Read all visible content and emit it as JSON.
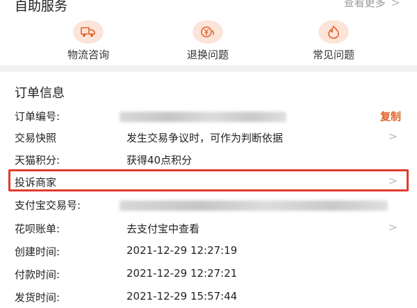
{
  "self_service": {
    "title": "自助服务",
    "see_more": "查看更多",
    "items": [
      {
        "label": "物流咨询",
        "icon": "truck-icon"
      },
      {
        "label": "退换问题",
        "icon": "yuan-exchange-icon"
      },
      {
        "label": "常见问题",
        "icon": "flame-question-icon"
      }
    ]
  },
  "order_info": {
    "title": "订单信息",
    "rows": [
      {
        "key": "订单编号:",
        "value": "",
        "action": "复制"
      },
      {
        "key": "交易快照",
        "value": "发生交易争议时，可作为判断依据"
      },
      {
        "key": "天猫积分:",
        "value": "获得40点积分"
      },
      {
        "key": "投诉商家",
        "value": ""
      },
      {
        "key": "支付宝交易号:",
        "value": ""
      },
      {
        "key": "花呗账单:",
        "value": "去支付宝中查看"
      },
      {
        "key": "创建时间:",
        "value": "2021-12-29 12:27:19"
      },
      {
        "key": "付款时间:",
        "value": "2021-12-29 12:27:21"
      },
      {
        "key": "发货时间:",
        "value": "2021-12-29 15:57:44"
      }
    ]
  },
  "colors": {
    "accent": "#e2622a",
    "highlight_border": "#e03a2c",
    "icon_bg": "#fde4d9"
  }
}
